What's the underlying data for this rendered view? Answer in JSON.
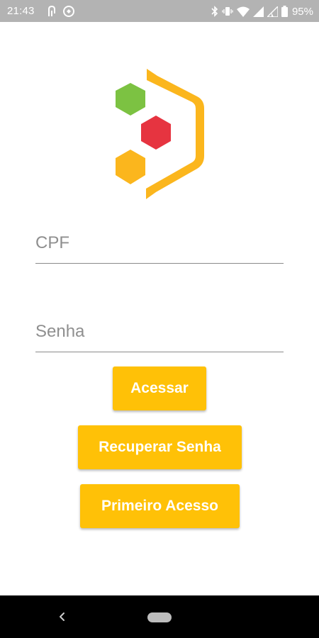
{
  "status_bar": {
    "time": "21:43",
    "battery_percent": "95%",
    "left_icons": [
      "nfc-icon",
      "sync-icon"
    ],
    "right_icons": [
      "bluetooth-icon",
      "vibrate-icon",
      "wifi-icon",
      "signal-icon",
      "signal-icon",
      "battery-icon"
    ]
  },
  "logo": {
    "hex_colors": [
      "#7cc242",
      "#e63440",
      "#fbb61d"
    ],
    "bracket_color": "#fbb61d"
  },
  "form": {
    "cpf_placeholder": "CPF",
    "senha_placeholder": "Senha"
  },
  "buttons": {
    "acessar_label": "Acessar",
    "recuperar_label": "Recuperar Senha",
    "primeiro_label": "Primeiro Acesso",
    "color": "#ffc107"
  },
  "nav_bar": {
    "icons": [
      "back-icon",
      "home-pill-icon"
    ]
  }
}
